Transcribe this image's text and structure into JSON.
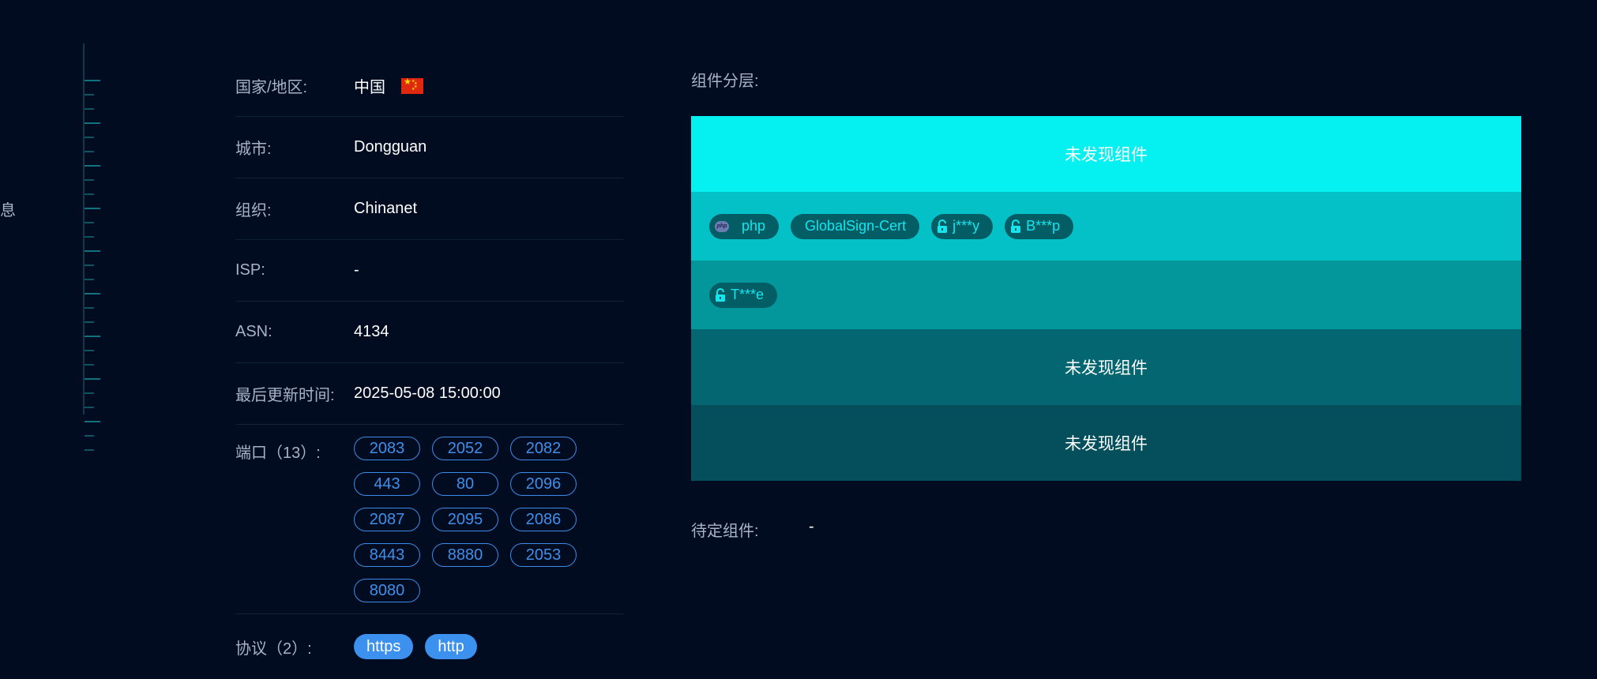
{
  "edge_text": "息",
  "info": {
    "country": {
      "label": "国家/地区:",
      "value": "中国",
      "flag_icon": "china-flag-icon"
    },
    "city": {
      "label": "城市:",
      "value": "Dongguan"
    },
    "org": {
      "label": "组织:",
      "value": "Chinanet"
    },
    "isp": {
      "label": "ISP:",
      "value": "-"
    },
    "asn": {
      "label": "ASN:",
      "value": "4134"
    },
    "updated": {
      "label": "最后更新时间:",
      "value": "2025-05-08 15:00:00"
    },
    "ports": {
      "label": "端口（13）:",
      "items": [
        "2083",
        "2052",
        "2082",
        "443",
        "80",
        "2096",
        "2087",
        "2095",
        "2086",
        "8443",
        "8880",
        "2053",
        "8080"
      ]
    },
    "protocols": {
      "label": "协议（2）:",
      "items": [
        "https",
        "http"
      ]
    }
  },
  "layers": {
    "label": "组件分层:",
    "empty_text": "未发现组件",
    "row2": [
      {
        "name": "php",
        "icon": "php-icon"
      },
      {
        "name": "GlobalSign-Cert",
        "icon": ""
      },
      {
        "name": "j***y",
        "icon": "lock-icon"
      },
      {
        "name": "B***p",
        "icon": "lock-icon"
      }
    ],
    "row3": [
      {
        "name": "T***e",
        "icon": "lock-icon"
      }
    ]
  },
  "pending": {
    "label": "待定组件:",
    "value": "-"
  },
  "colors": {
    "background": "#020c20",
    "label": "#a7b3c6",
    "port_chip": "#3b8be8",
    "protocol_chip": "#3c91ee",
    "layer1": "#05f0f0",
    "layer2": "#04c1c7",
    "layer3": "#03969b",
    "layer4": "#046670",
    "layer5": "#044f5b",
    "component_chip": "#035d65",
    "component_text": "#15e6ee"
  }
}
